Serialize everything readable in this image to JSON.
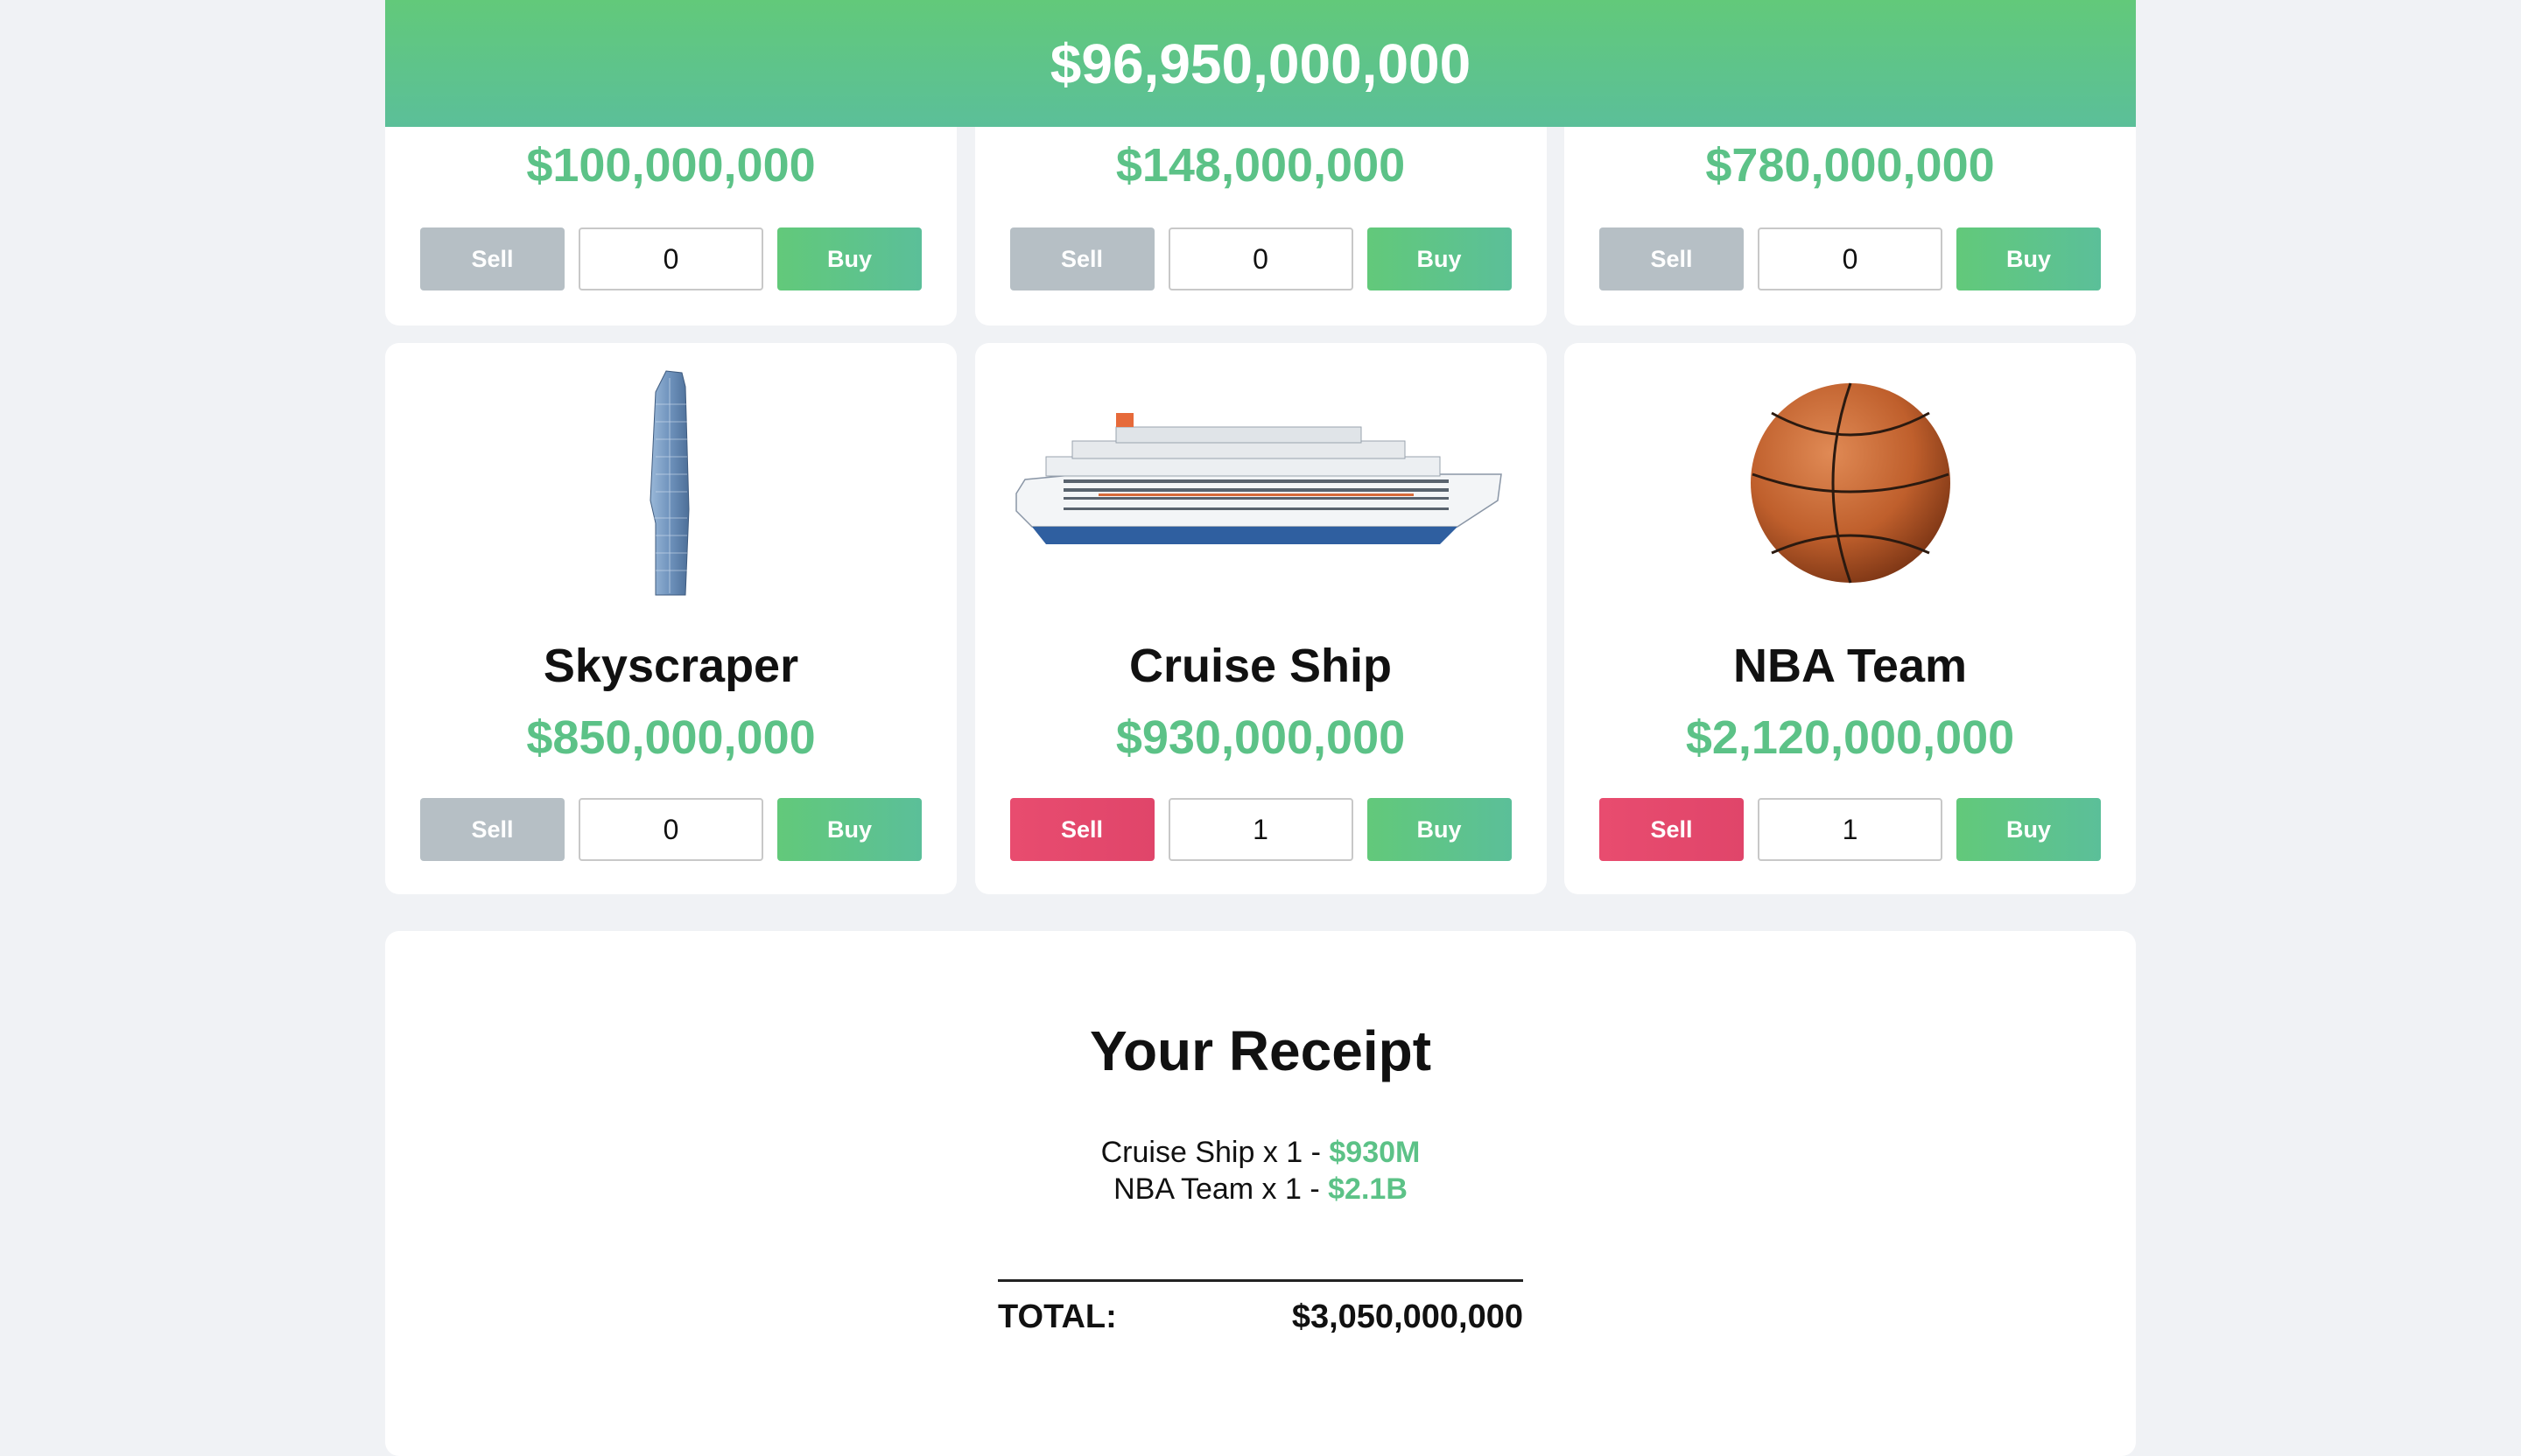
{
  "balance": "$96,950,000,000",
  "items_top": [
    {
      "price": "$100,000,000",
      "sell_label": "Sell",
      "quantity": "0",
      "buy_label": "Buy"
    },
    {
      "price": "$148,000,000",
      "sell_label": "Sell",
      "quantity": "0",
      "buy_label": "Buy"
    },
    {
      "price": "$780,000,000",
      "sell_label": "Sell",
      "quantity": "0",
      "buy_label": "Buy"
    }
  ],
  "items_bottom": [
    {
      "name": "Skyscraper",
      "price": "$850,000,000",
      "sell_label": "Sell",
      "quantity": "0",
      "buy_label": "Buy",
      "icon": "skyscraper-icon"
    },
    {
      "name": "Cruise Ship",
      "price": "$930,000,000",
      "sell_label": "Sell",
      "quantity": "1",
      "buy_label": "Buy",
      "icon": "cruise-ship-icon"
    },
    {
      "name": "NBA Team",
      "price": "$2,120,000,000",
      "sell_label": "Sell",
      "quantity": "1",
      "buy_label": "Buy",
      "icon": "basketball-icon"
    }
  ],
  "receipt": {
    "title": "Your Receipt",
    "lines": [
      {
        "label": "Cruise Ship x 1 - ",
        "amount": "$930M"
      },
      {
        "label": "NBA Team x 1 - ",
        "amount": "$2.1B"
      }
    ],
    "total_label": "TOTAL:",
    "total_value": "$3,050,000,000"
  },
  "colors": {
    "green": "#5cc287",
    "sell_active": "#e84c6f",
    "sell_disabled": "#b6bfc5",
    "background": "#f0f2f5"
  }
}
